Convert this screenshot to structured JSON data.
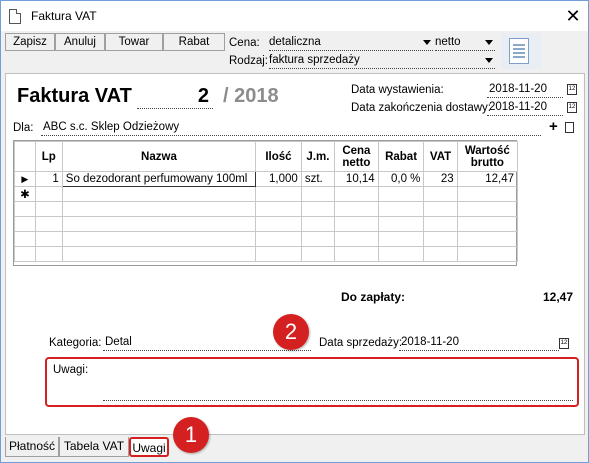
{
  "window": {
    "title": "Faktura VAT",
    "close": "✕"
  },
  "toolbar": {
    "buttons": [
      "Zapisz",
      "Anuluj",
      "Towar",
      "Rabat"
    ]
  },
  "price": {
    "label": "Cena:",
    "value": "detaliczna",
    "mode": "netto"
  },
  "kind": {
    "label": "Rodzaj:",
    "value": "faktura sprzedaży"
  },
  "invoice": {
    "title": "Faktura VAT",
    "number": "2",
    "year": "/ 2018"
  },
  "dates": {
    "issue_label": "Data wystawienia:",
    "issue_value": "2018-11-20",
    "delivery_label": "Data zakończenia dostawy:",
    "delivery_value": "2018-11-20",
    "sale_label": "Data sprzedaży:",
    "sale_value": "2018-11-20"
  },
  "buyer": {
    "label": "Dla:",
    "value": "ABC s.c. Sklep Odzieżowy",
    "add": "+"
  },
  "table": {
    "headers": [
      "Lp",
      "Nazwa",
      "Ilość",
      "J.m.",
      "Cena netto",
      "Rabat",
      "VAT",
      "Wartość brutto"
    ],
    "rows": [
      {
        "marker": "▶",
        "lp": "1",
        "name": "So dezodorant perfumowany 100ml",
        "qty": "1,000",
        "unit": "szt.",
        "price": "10,14",
        "discount": "0,0 %",
        "vat": "23",
        "gross": "12,47"
      }
    ],
    "new_row_marker": "✱"
  },
  "summary": {
    "label": "Do zapłaty:",
    "value": "12,47"
  },
  "category": {
    "label": "Kategoria:",
    "value": "Detal"
  },
  "notes": {
    "label": "Uwagi:",
    "value": ""
  },
  "callouts": {
    "one": "1",
    "two": "2"
  },
  "tabs": [
    "Płatność",
    "Tabela VAT",
    "Uwagi"
  ],
  "colors": {
    "highlight": "#d42020",
    "year": "#8c8c8c"
  }
}
